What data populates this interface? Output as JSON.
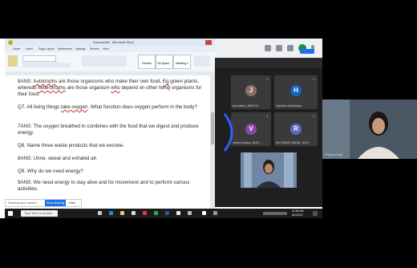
{
  "word": {
    "title": "Document8 - Microsoft Word",
    "tabs": [
      "Home",
      "Insert",
      "Page Layout",
      "References",
      "Mailings",
      "Review",
      "View"
    ],
    "styles": [
      "Normal",
      "No Spaci...",
      "Heading 1"
    ],
    "paragraphs": [
      {
        "id": "a8",
        "parts": [
          {
            "t": "8ANS: ",
            "u": false
          },
          {
            "t": "Autotrophs",
            "u": true
          },
          {
            "t": " are those organisms who make their own food, ",
            "u": false
          },
          {
            "t": "Eg",
            "u": true
          },
          {
            "t": " green plants, whereas ",
            "u": false
          },
          {
            "t": "heterotrophs",
            "u": true
          },
          {
            "t": " are those organism ",
            "u": false
          },
          {
            "t": "who",
            "u": true
          },
          {
            "t": " depend on other living organisms for their food.",
            "u": false
          }
        ]
      },
      {
        "id": "q7",
        "parts": [
          {
            "t": "Q7. All living things ",
            "u": false
          },
          {
            "t": "take  oxygen",
            "u": true
          },
          {
            "t": ". What function does oxygen perform in the body?",
            "u": false
          }
        ]
      },
      {
        "id": "a7",
        "parts": [
          {
            "t": "7ANS: The oxygen breathed in combines with the food that we digest and produce energy.",
            "u": false
          }
        ]
      },
      {
        "id": "q8",
        "parts": [
          {
            "t": "Q8. Name three waste products that we excrete.",
            "u": false
          }
        ]
      },
      {
        "id": "a8b",
        "parts": [
          {
            "t": "8ANS: Urine, sweat and exhaled air.",
            "u": false
          }
        ]
      },
      {
        "id": "q9",
        "parts": [
          {
            "t": "Q9. Why do we need energy?",
            "u": false
          }
        ]
      },
      {
        "id": "a9",
        "parts": [
          {
            "t": "9ANS: We need energy to stay alive and for movement and to perform various activities.",
            "u": false
          }
        ]
      }
    ]
  },
  "meeting": {
    "tiles": [
      {
        "initial": "J",
        "color": "#8d6e63",
        "name": "jeet kakkar_8026 7A",
        "num": "1"
      },
      {
        "initial": "H",
        "color": "#1565c0",
        "name": "Harsheta Kaushalya",
        "num": "1"
      },
      {
        "initial": "V",
        "color": "#8e44ad",
        "name": "vibhavi Kakkar_8026 ...",
        "num": "1"
      },
      {
        "initial": "R",
        "color": "#5c6bc0",
        "name": "RAJ SINGH SAHNI_7B 4F",
        "num": "1"
      }
    ],
    "side_name": "Ritika Ahuja"
  },
  "taskbar": {
    "search_placeholder": "Type here to search",
    "time": "11:56 AM",
    "date": "8/2/2022"
  },
  "notification": {
    "text": "Sharing your screen",
    "button": "Stop sharing",
    "close": "Hide"
  }
}
